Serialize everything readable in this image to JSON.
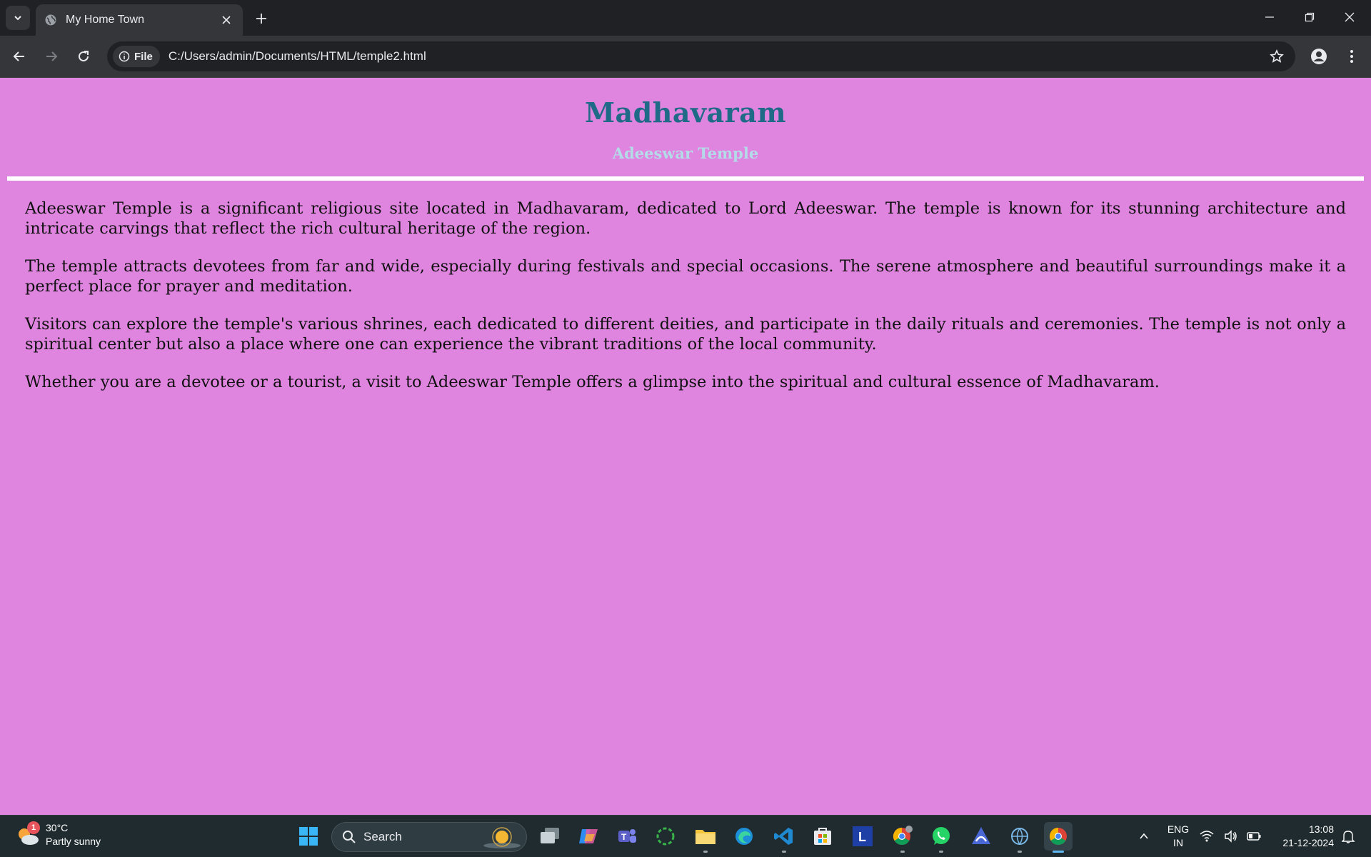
{
  "browser": {
    "tab_title": "My Home Town",
    "site_chip": "File",
    "url": "C:/Users/admin/Documents/HTML/temple2.html"
  },
  "page": {
    "title": "Madhavaram",
    "subtitle": "Adeeswar Temple",
    "paragraphs": [
      "Adeeswar Temple is a significant religious site located in Madhavaram, dedicated to Lord Adeeswar. The temple is known for its stunning architecture and intricate carvings that reflect the rich cultural heritage of the region.",
      "The temple attracts devotees from far and wide, especially during festivals and special occasions. The serene atmosphere and beautiful surroundings make it a perfect place for prayer and meditation.",
      "Visitors can explore the temple's various shrines, each dedicated to different deities, and participate in the daily rituals and ceremonies. The temple is not only a spiritual center but also a place where one can experience the vibrant traditions of the local community.",
      "Whether you are a devotee or a tourist, a visit to Adeeswar Temple offers a glimpse into the spiritual and cultural essence of Madhavaram."
    ],
    "colors": {
      "background": "#df84df",
      "title": "#1f6a86",
      "subtitle": "#b4dbe8"
    }
  },
  "taskbar": {
    "weather_badge": "1",
    "temperature": "30°C",
    "condition": "Partly sunny",
    "search_placeholder": "Search",
    "lang_line1": "ENG",
    "lang_line2": "IN",
    "time": "13:08",
    "date": "21-12-2024",
    "pinned_icons": [
      "windows-start-icon",
      "task-view-icon",
      "copilot-icon",
      "teams-icon",
      "loader-app-icon",
      "file-explorer-icon",
      "edge-icon",
      "vscode-icon",
      "store-icon",
      "l-app-icon",
      "chrome-profile-icon",
      "whatsapp-icon",
      "arc-icon",
      "network-app-icon",
      "chrome-icon"
    ]
  }
}
